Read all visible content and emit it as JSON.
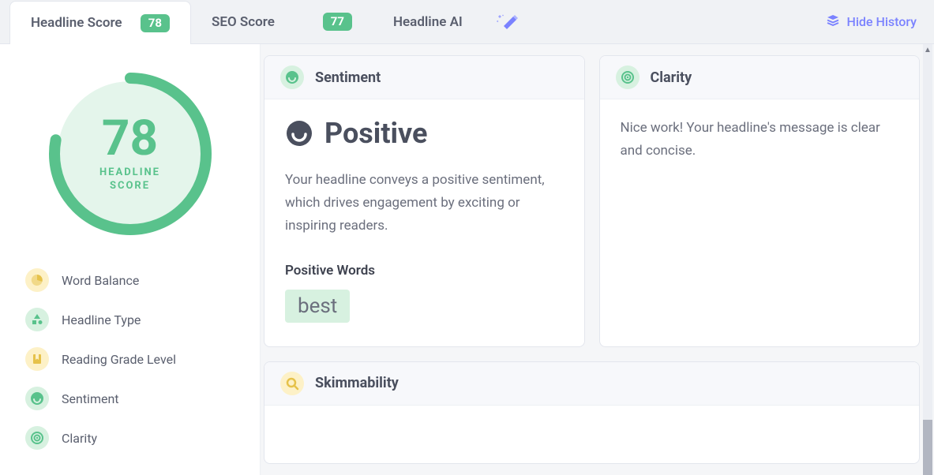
{
  "tabs": [
    {
      "label": "Headline Score",
      "badge": "78",
      "active": true
    },
    {
      "label": "SEO Score",
      "badge": "77",
      "active": false
    },
    {
      "label": "Headline AI",
      "badge": null,
      "active": false
    }
  ],
  "hide_history_label": "Hide History",
  "score": {
    "value": "78",
    "label_line1": "HEADLINE",
    "label_line2": "SCORE",
    "percent": 78
  },
  "metrics": [
    {
      "label": "Word Balance",
      "color": "yellow",
      "icon": "pie"
    },
    {
      "label": "Headline Type",
      "color": "green",
      "icon": "shapes"
    },
    {
      "label": "Reading Grade Level",
      "color": "yellow",
      "icon": "bookmark"
    },
    {
      "label": "Sentiment",
      "color": "green",
      "icon": "smile"
    },
    {
      "label": "Clarity",
      "color": "green",
      "icon": "target"
    }
  ],
  "sentiment_card": {
    "title": "Sentiment",
    "headline": "Positive",
    "description": "Your headline conveys a positive sentiment, which drives engagement by exciting or inspiring readers.",
    "subhead": "Positive Words",
    "chip": "best"
  },
  "clarity_card": {
    "title": "Clarity",
    "description": "Nice work! Your headline's message is clear and concise."
  },
  "skim_card": {
    "title": "Skimmability"
  }
}
